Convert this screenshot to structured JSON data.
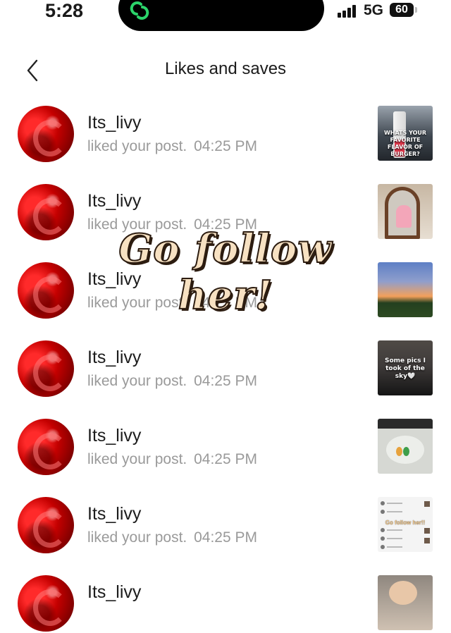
{
  "status_bar": {
    "time": "5:28",
    "network": "5G",
    "battery": "60"
  },
  "header": {
    "title": "Likes and saves",
    "back_icon": "chevron-left-icon"
  },
  "notifications": [
    {
      "username": "Its_livy",
      "action": "liked your post.",
      "time": "04:25 PM",
      "thumb_caption": "WHATS YOUR FAVORITE FLAVOR OF BURGER?"
    },
    {
      "username": "Its_livy",
      "action": "liked your post.",
      "time": "04:25 PM",
      "thumb_caption": ""
    },
    {
      "username": "Its_livy",
      "action": "liked your post.",
      "time": "04:25 PM",
      "thumb_caption": ""
    },
    {
      "username": "Its_livy",
      "action": "liked your post.",
      "time": "04:25 PM",
      "thumb_caption": "Some pics I took of the sky🤍"
    },
    {
      "username": "Its_livy",
      "action": "liked your post.",
      "time": "04:25 PM",
      "thumb_caption": ""
    },
    {
      "username": "Its_livy",
      "action": "liked your post.",
      "time": "04:25 PM",
      "thumb_caption": "Go follow her!!"
    },
    {
      "username": "Its_livy",
      "action": "",
      "time": "",
      "thumb_caption": ""
    }
  ],
  "overlay": {
    "text": "Go follow her!"
  }
}
